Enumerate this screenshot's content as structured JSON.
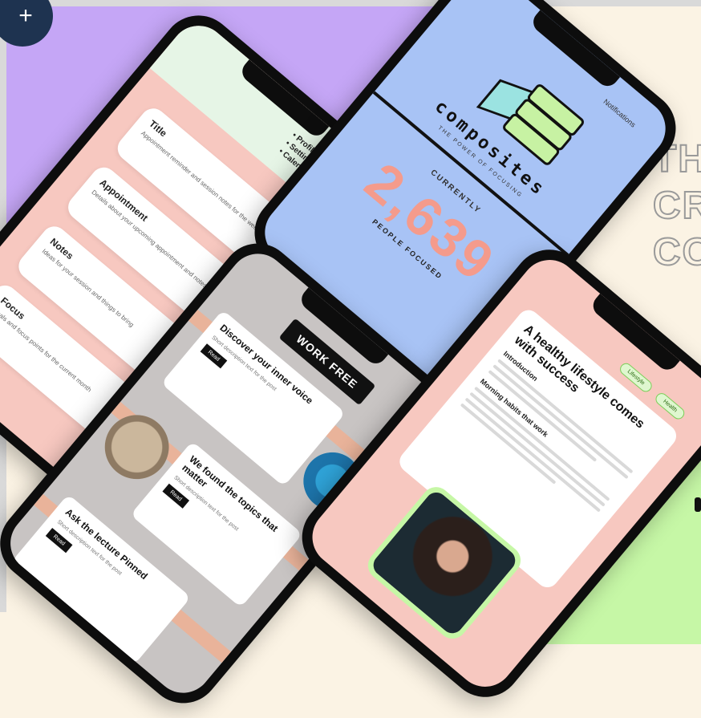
{
  "add_button": {
    "label": "+"
  },
  "headline": {
    "line1": "TH",
    "line2": "CR",
    "line3": "CO"
  },
  "phone_pink": {
    "top_list": [
      "• Profile",
      "• Settings",
      "• Calendar"
    ],
    "cards": [
      {
        "title": "Title",
        "text": "Appointment reminder and session notes for the week"
      },
      {
        "title": "Appointment",
        "text": "Details about your upcoming appointment and notes"
      },
      {
        "title": "Notes",
        "text": "Ideas for your session and things to bring"
      },
      {
        "title": "Focus",
        "text": "Goals and focus points for the current month"
      }
    ]
  },
  "phone_blue": {
    "top_text": "Notifications",
    "brand": "composites",
    "tagline": "THE POWER OF FOCUSING",
    "current_label": "CURRENTLY",
    "big_number": "2,639",
    "under_label": "PEOPLE FOCUSED"
  },
  "phone_grey": {
    "pill": "WORK FREE",
    "cards": [
      {
        "title": "Discover your inner voice",
        "text": "Short description text for the post",
        "button": "Read"
      },
      {
        "title": "We found the topics that matter",
        "text": "Short description text for the post",
        "button": "Read"
      },
      {
        "title": "Ask the lecture Pinned",
        "text": "Short description text for the post",
        "button": "Read"
      }
    ]
  },
  "phone_article": {
    "tags": [
      "Lifestyle",
      "Health"
    ],
    "title": "A healthy lifestyle comes with success",
    "sub1": "Introduction",
    "sub2": "Morning habits that work"
  }
}
